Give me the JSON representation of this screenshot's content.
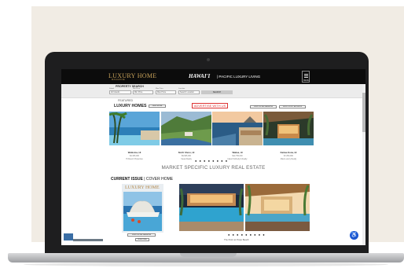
{
  "header": {
    "brand": "LUXURY HOME",
    "brand_sub": "MAGAZINE",
    "edition": "HAWAI'I",
    "tagline": "| PACIFIC LUXURY LIVING",
    "menu_label": "MENU"
  },
  "search": {
    "title": "PROPERTY SEARCH",
    "fields": [
      {
        "label": "Island",
        "value": "All Islands"
      },
      {
        "label": "Min Price",
        "value": "Min Price"
      },
      {
        "label": "Max Price",
        "value": "Max Price"
      },
      {
        "label": "Location",
        "value": "Search Location"
      }
    ],
    "button": "SEARCH"
  },
  "featured": {
    "eyebrow": "FEATURED",
    "title": "LUXURY HOMES",
    "view_more": "VIEW MORE",
    "advertise": "ADVERTISE WITH US",
    "buttons": [
      "VIEW DIGITAL MAGAZINE",
      "VIEW LUXURY ARCHIVES"
    ],
    "listings": [
      {
        "name": "Waikoloa, HI",
        "price": "$3,495,000",
        "details": "4bd | 4.5ba | 3,844 sf",
        "agent": "Hi Resort Properties"
      },
      {
        "name": "North Shore, HI",
        "price": "$9,995,000",
        "details": "5bd | 6ba | 6,200 sf",
        "agent": "Kauai Realty"
      },
      {
        "name": "Wailea, HI",
        "price": "$12,750,000",
        "details": "6bd | 7ba | 7,100 sf",
        "agent": "Island Sotheby's Realty"
      },
      {
        "name": "Kailua-Kona, HI",
        "price": "$7,250,000",
        "details": "4bd | 5ba | 5,420 sf",
        "agent": "Maui Luxury Realty"
      }
    ],
    "dots": "● ● ● ● ● ● ● ●"
  },
  "market_heading": "MARKET SPECIFIC LUXURY REAL ESTATE",
  "current_issue": {
    "label_bold": "CURRENT ISSUE",
    "label_rest": " | COVER HOME",
    "mag_title": "LUXURY HOME",
    "btn_digital": "VIEW DIGITAL MAGAZINE",
    "btn_subscribe": "SUBSCRIBE",
    "dots": "● ● ● ● ● ● ● ● ●",
    "caption": "The Point at Poipu Beach"
  },
  "accessibility": {
    "icon": "accessibility-icon",
    "color": "#1a56d6"
  },
  "colors": {
    "gold": "#c8a25a",
    "advertise": "#dd3333",
    "header_bg": "#0c0c0c"
  }
}
